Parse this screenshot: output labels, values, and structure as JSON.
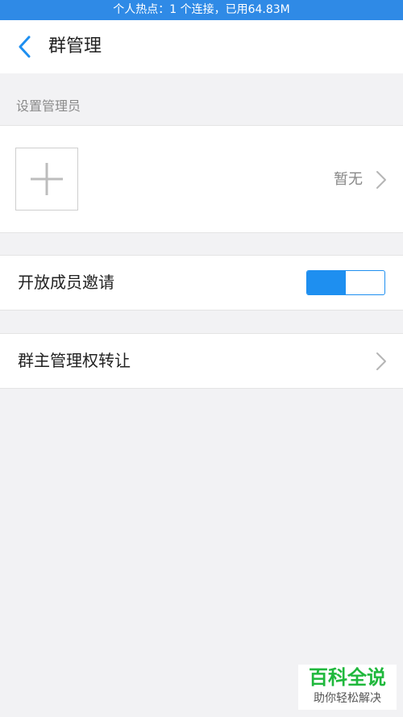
{
  "status_bar": {
    "text": "个人热点：1 个连接，已用64.83M"
  },
  "header": {
    "title": "群管理",
    "back_icon": "chevron-left-icon"
  },
  "admin_section": {
    "header": "设置管理员",
    "add_icon": "plus-icon",
    "value": "暂无",
    "chevron_icon": "chevron-right-icon"
  },
  "settings": [
    {
      "label": "开放成员邀请",
      "control": "toggle",
      "on": true
    },
    {
      "label": "群主管理权转让",
      "control": "chevron"
    }
  ],
  "watermark": {
    "title": "百科全说",
    "subtitle": "助你轻松解决"
  },
  "colors": {
    "accent": "#1e8ff0",
    "status_bar": "#2f8ae6",
    "background": "#f2f2f4",
    "watermark_green": "#1fb83c"
  }
}
